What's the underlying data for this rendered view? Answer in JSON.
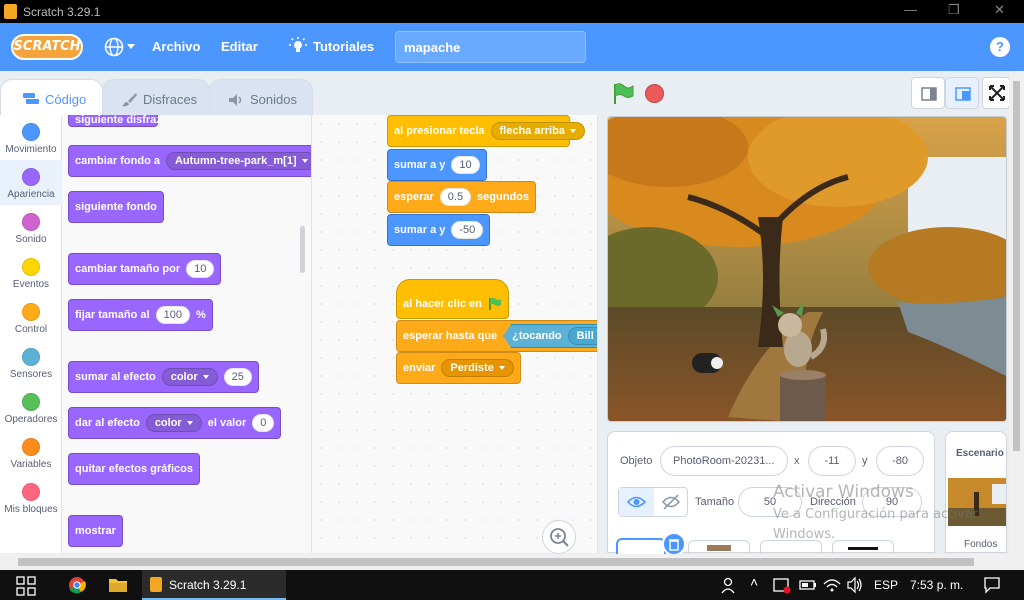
{
  "window": {
    "title": "Scratch 3.29.1",
    "controls": [
      "—",
      "❐",
      "✕"
    ]
  },
  "menubar": {
    "logo": "SCRATCH",
    "file": "Archivo",
    "edit": "Editar",
    "tutorials": "Tutoriales",
    "project_name": "mapache",
    "help": "?"
  },
  "tabs": {
    "code": "Código",
    "costumes": "Disfraces",
    "sounds": "Sonidos"
  },
  "categories": [
    {
      "label": "Movimiento",
      "color": "#4c97ff"
    },
    {
      "label": "Apariencia",
      "color": "#9966ff"
    },
    {
      "label": "Sonido",
      "color": "#cf63cf"
    },
    {
      "label": "Eventos",
      "color": "#ffd500"
    },
    {
      "label": "Control",
      "color": "#ffab19"
    },
    {
      "label": "Sensores",
      "color": "#5cb1d6"
    },
    {
      "label": "Operadores",
      "color": "#59c059"
    },
    {
      "label": "Variables",
      "color": "#ff8c1a"
    },
    {
      "label": "Mis bloques",
      "color": "#ff6680"
    }
  ],
  "palette_blocks": {
    "next_backdrop_cut": "siguiente disfraz",
    "switch_backdrop": "cambiar fondo a",
    "switch_backdrop_value": "Autumn-tree-park_m[1]",
    "next_backdrop": "siguiente fondo",
    "change_size": "cambiar tamaño por",
    "change_size_value": "10",
    "set_size": "fijar tamaño al",
    "set_size_value": "100",
    "set_size_unit": "%",
    "change_effect": "sumar al efecto",
    "change_effect_dd": "color",
    "change_effect_value": "25",
    "set_effect": "dar al efecto",
    "set_effect_dd": "color",
    "set_effect_mid": "el valor",
    "set_effect_value": "0",
    "clear_effects": "quitar efectos gráficos",
    "show": "mostrar"
  },
  "script1": {
    "hat": "al presionar tecla",
    "hat_key": "flecha arriba",
    "b1": "sumar a y",
    "b1_val": "10",
    "b2": "esperar",
    "b2_val": "0.5",
    "b2_tail": "segundos",
    "b3": "sumar a y",
    "b3_val": "-50"
  },
  "script2": {
    "hat": "al hacer clic en",
    "b1": "esperar hasta que",
    "b1_cond": "¿tocando",
    "b1_cond_val": "Bill",
    "b2": "enviar",
    "b2_val": "Perdiste"
  },
  "sprite_info": {
    "sprite_label": "Objeto",
    "sprite_name": "PhotoRoom-20231...",
    "x_label": "x",
    "x_value": "-11",
    "y_label": "y",
    "y_value": "-80",
    "size_label": "Tamaño",
    "size_value": "50",
    "direction_label": "Dirección",
    "direction_value": "90"
  },
  "stage_panel": {
    "title": "Escenario",
    "backdrops_label": "Fondos"
  },
  "watermark": {
    "line1": "Activar Windows",
    "line2": "Ve a Configuración para activar",
    "line3": "Windows."
  },
  "taskbar": {
    "app": "Scratch 3.29.1",
    "lang": "ESP",
    "time": "7:53 p. m."
  }
}
